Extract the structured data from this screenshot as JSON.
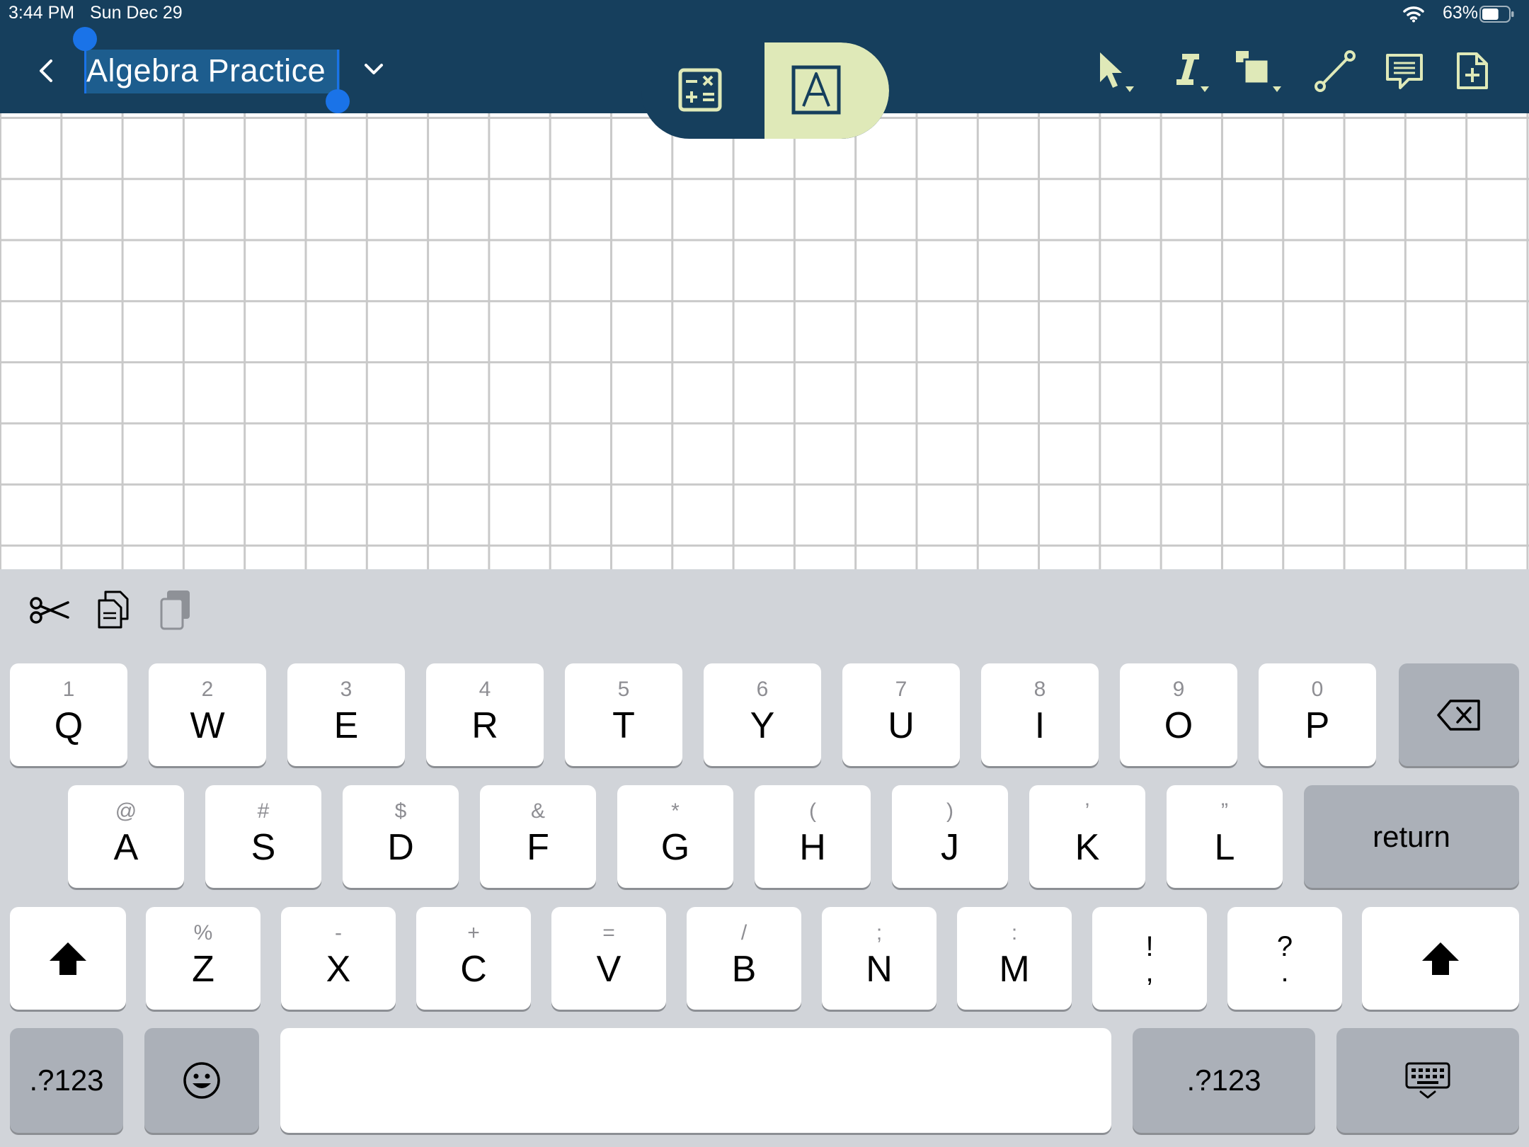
{
  "status_bar": {
    "time": "3:44 PM",
    "date": "Sun Dec 29",
    "battery_percent": "63%",
    "battery_level": 0.63
  },
  "nav": {
    "document_title": "Algebra Practice",
    "title_selected": true,
    "active_mode": "document",
    "colors": {
      "bar_background": "#163f5d",
      "accent": "#dfe9b8",
      "selection": "#1a73e8"
    },
    "icons": {
      "back": "chevron-left-icon",
      "title_menu": "chevron-down-icon",
      "calculator_mode": "calculator-icon",
      "text_mode": "text-box-icon",
      "select_tool": "pointer-arrow-icon",
      "text_tool": "italic-text-icon",
      "shape_tool": "shapes-icon",
      "line_tool": "line-segment-icon",
      "comment_tool": "comment-icon",
      "add_page": "add-page-icon"
    }
  },
  "canvas": {
    "background": "graph-paper-grid"
  },
  "keyboard": {
    "edit_icons": [
      "scissors-icon",
      "copy-icon",
      "paste-icon"
    ],
    "row1": [
      {
        "main": "Q",
        "alt": "1"
      },
      {
        "main": "W",
        "alt": "2"
      },
      {
        "main": "E",
        "alt": "3"
      },
      {
        "main": "R",
        "alt": "4"
      },
      {
        "main": "T",
        "alt": "5"
      },
      {
        "main": "Y",
        "alt": "6"
      },
      {
        "main": "U",
        "alt": "7"
      },
      {
        "main": "I",
        "alt": "8"
      },
      {
        "main": "O",
        "alt": "9"
      },
      {
        "main": "P",
        "alt": "0"
      }
    ],
    "row2": [
      {
        "main": "A",
        "alt": "@"
      },
      {
        "main": "S",
        "alt": "#"
      },
      {
        "main": "D",
        "alt": "$"
      },
      {
        "main": "F",
        "alt": "&"
      },
      {
        "main": "G",
        "alt": "*"
      },
      {
        "main": "H",
        "alt": "("
      },
      {
        "main": "J",
        "alt": ")"
      },
      {
        "main": "K",
        "alt": "’"
      },
      {
        "main": "L",
        "alt": "”"
      }
    ],
    "row3": [
      {
        "main": "Z",
        "alt": "%"
      },
      {
        "main": "X",
        "alt": "-"
      },
      {
        "main": "C",
        "alt": "+"
      },
      {
        "main": "V",
        "alt": "="
      },
      {
        "main": "B",
        "alt": "/"
      },
      {
        "main": "N",
        "alt": ";"
      },
      {
        "main": "M",
        "alt": ":"
      },
      {
        "main": ",",
        "alt": "!"
      },
      {
        "main": ".",
        "alt": "?"
      }
    ],
    "return_label": "return",
    "numbers_label": ".?123",
    "backspace_icon": "backspace-icon",
    "shift_icon": "shift-icon",
    "emoji_icon": "emoji-icon",
    "dismiss_icon": "keyboard-dismiss-icon"
  }
}
